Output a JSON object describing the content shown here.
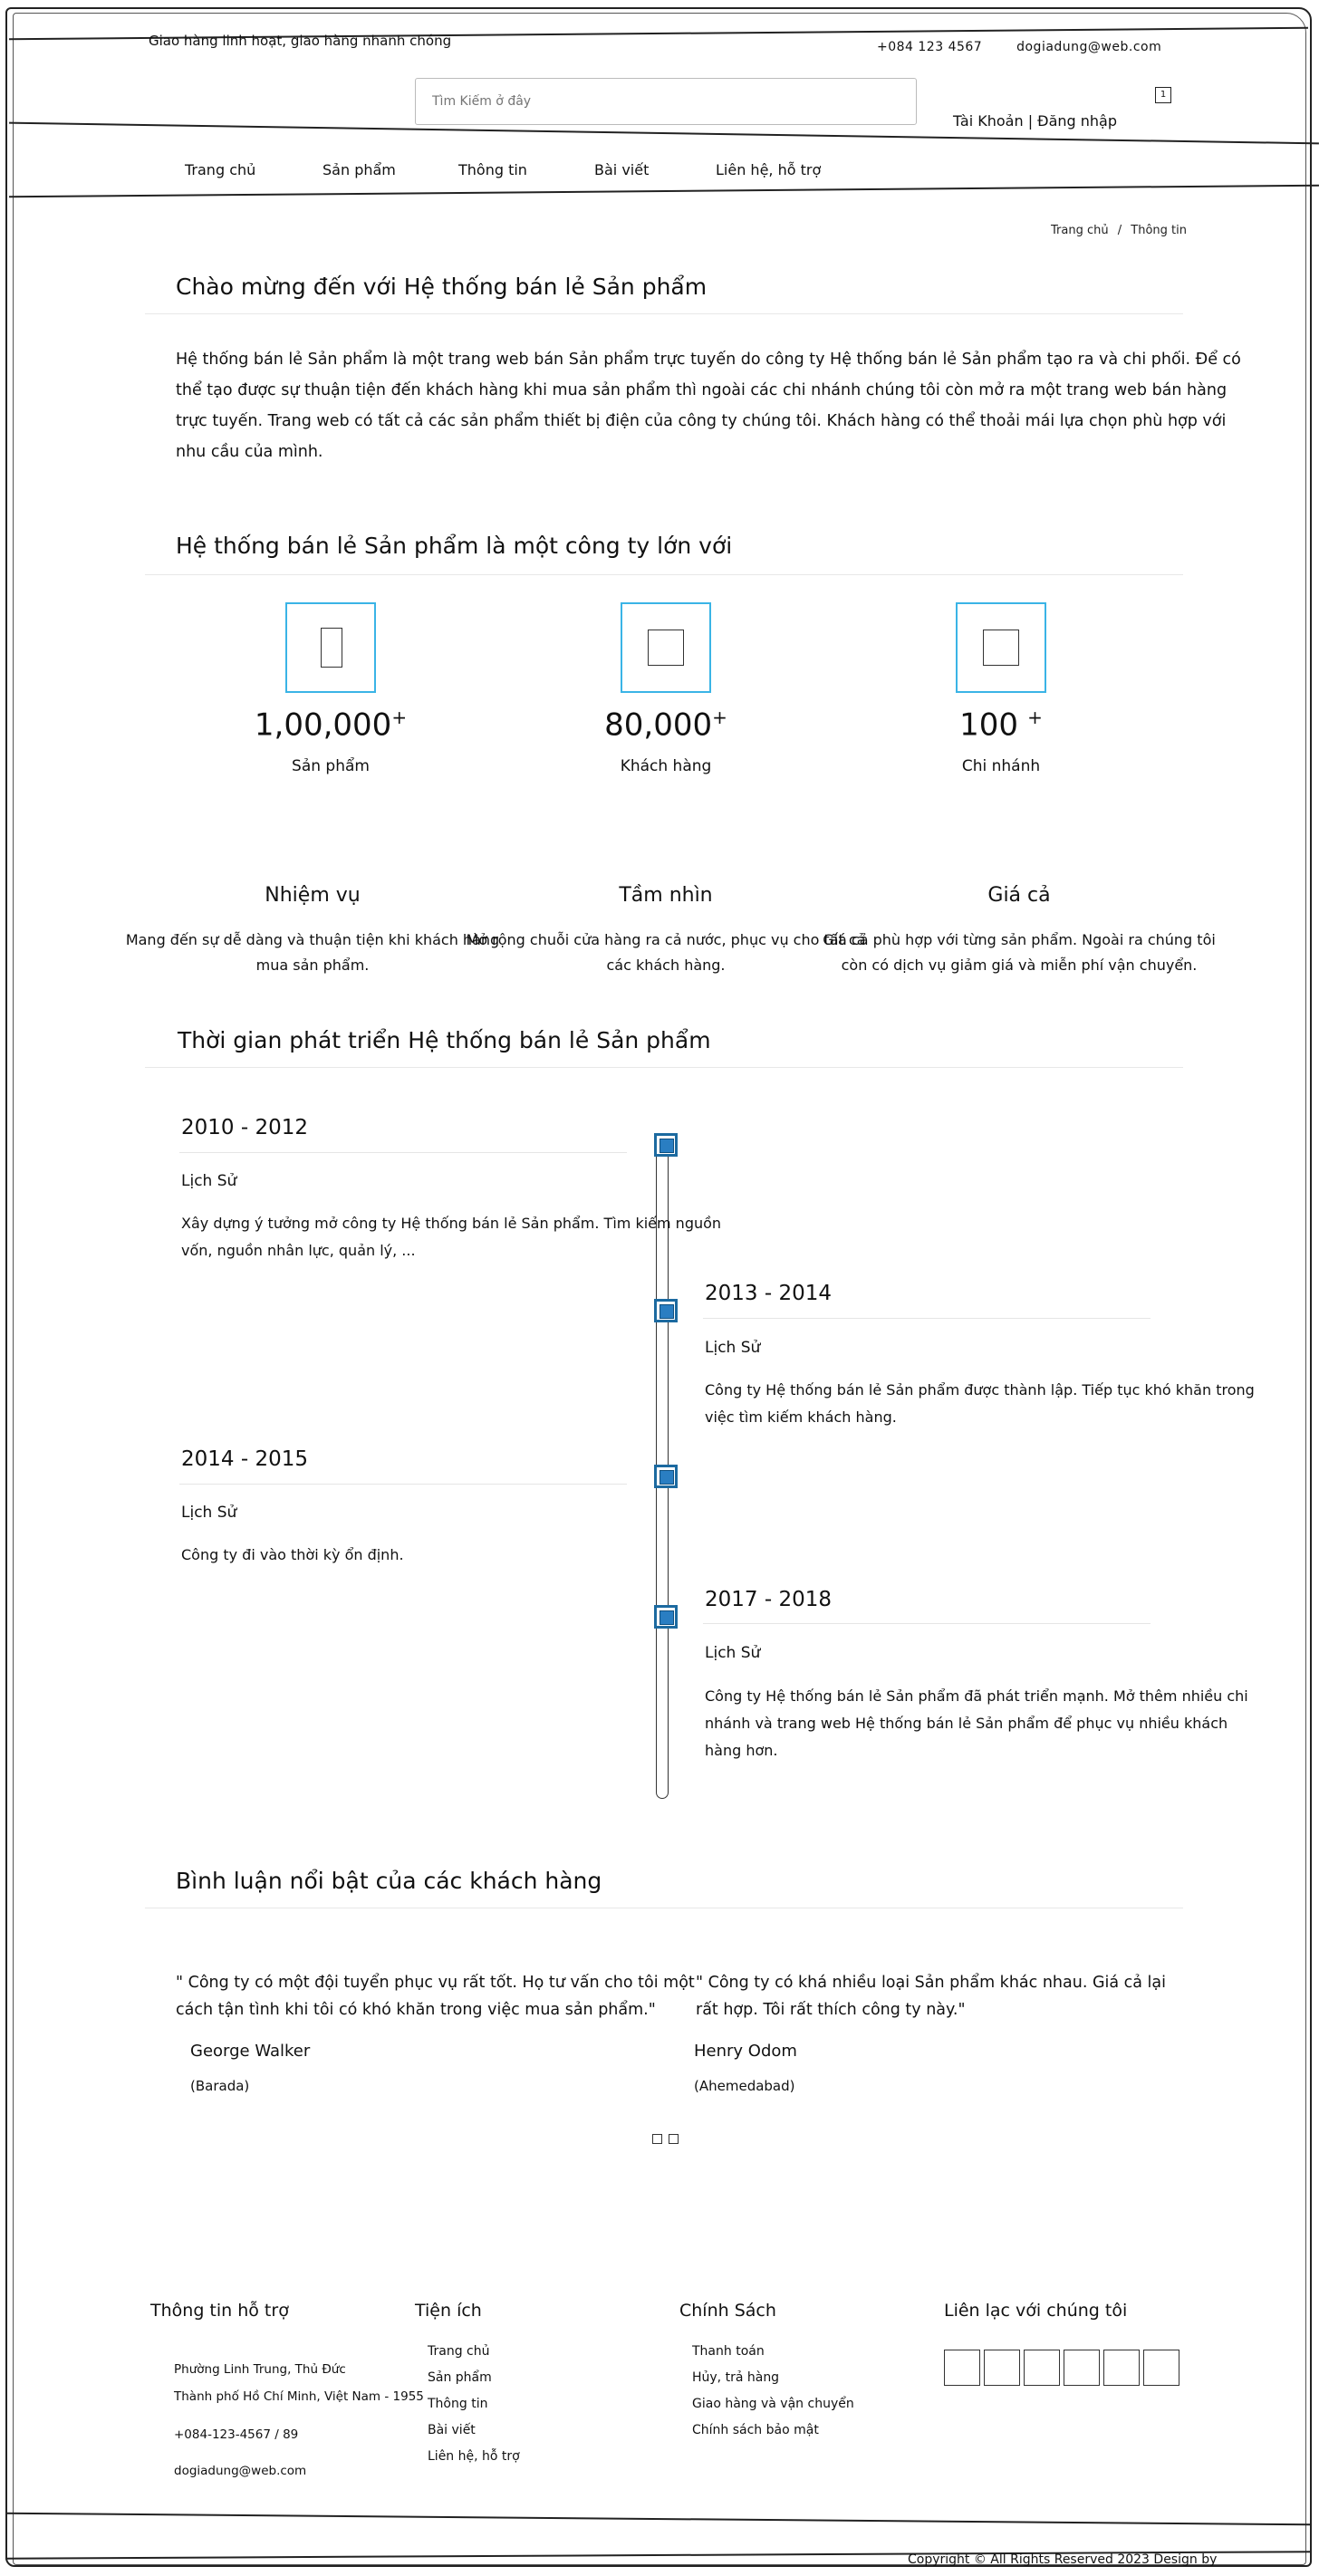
{
  "topbar": {
    "tagline": "Giao hàng linh hoạt, giao hàng nhanh chóng",
    "phone": "+084 123 4567",
    "email": "dogiadung@web.com"
  },
  "header": {
    "search_placeholder": "Tìm Kiếm ở đây",
    "cart_count": "1",
    "account_label": "Tài Khoản | Đăng nhập"
  },
  "nav": {
    "items": [
      "Trang chủ",
      "Sản phẩm",
      "Thông tin",
      "Bài viết",
      "Liên hệ, hỗ trợ"
    ]
  },
  "breadcrumb": {
    "home": "Trang chủ",
    "separator": "/",
    "current": "Thông tin"
  },
  "welcome": {
    "title": "Chào mừng đến với Hệ thống bán lẻ Sản phẩm",
    "paragraph": "Hệ thống bán lẻ Sản phẩm là một trang web bán Sản phẩm trực tuyến do công ty Hệ thống bán lẻ Sản phẩm tạo ra và chi phối. Để có thể tạo được sự thuận tiện đến khách hàng khi mua sản phẩm thì ngoài các chi nhánh chúng tôi còn mở ra một trang web bán hàng trực tuyến. Trang web có tất cả các sản phẩm thiết bị điện của công ty chúng tôi. Khách hàng có thể thoải mái lựa chọn phù hợp với nhu cầu của mình."
  },
  "stats": {
    "title": "Hệ thống bán lẻ Sản phẩm là một công ty lớn với",
    "items": [
      {
        "number": "1,00,000",
        "suffix": "+",
        "label": "Sản phẩm",
        "icon": "product-icon"
      },
      {
        "number": "80,000",
        "suffix": "+",
        "label": "Khách hàng",
        "icon": "customer-icon"
      },
      {
        "number": "100",
        "suffix": "+",
        "label": "Chi nhánh",
        "icon": "branch-icon"
      }
    ]
  },
  "mission": {
    "items": [
      {
        "title": "Nhiệm vụ",
        "text": "Mang đến sự dễ dàng và thuận tiện khi khách hàng mua sản phẩm."
      },
      {
        "title": "Tầm nhìn",
        "text": "Mở rộng chuỗi cửa hàng ra cả nước, phục vụ cho tất cả các khách hàng."
      },
      {
        "title": "Giá cả",
        "text": "Giá cả phù hợp với từng sản phẩm. Ngoài ra chúng tôi còn có dịch vụ giảm giá và miễn phí vận chuyển."
      }
    ]
  },
  "timeline": {
    "title": "Thời gian phát triển Hệ thống bán lẻ Sản phẩm",
    "entries": [
      {
        "date": "2010 - 2012",
        "subtitle": "Lịch Sử",
        "text": "Xây dựng ý tưởng mở công ty Hệ thống bán lẻ Sản phẩm. Tìm kiếm nguồn vốn, nguồn nhân lực, quản lý, ..."
      },
      {
        "date": "2013 - 2014",
        "subtitle": "Lịch Sử",
        "text": "Công ty Hệ thống bán lẻ Sản phẩm được thành lập. Tiếp tục khó khăn trong việc tìm kiếm khách hàng."
      },
      {
        "date": "2014 - 2015",
        "subtitle": "Lịch Sử",
        "text": "Công ty đi vào thời kỳ ổn định."
      },
      {
        "date": "2017 - 2018",
        "subtitle": "Lịch Sử",
        "text": "Công ty Hệ thống bán lẻ Sản phẩm đã phát triển mạnh. Mở thêm nhiều chi nhánh và trang web Hệ thống bán lẻ Sản phẩm để phục vụ nhiều khách hàng hơn."
      }
    ]
  },
  "reviews": {
    "title": "Bình luận nổi bật của các khách hàng",
    "items": [
      {
        "quote": "\" Công ty có một đội tuyển phục vụ rất tốt. Họ tư vấn cho tôi một cách tận tình khi tôi có khó khăn trong việc mua sản phẩm.\"",
        "name": "George Walker",
        "place": "(Barada)"
      },
      {
        "quote": "\" Công ty có khá nhiều loại Sản phẩm khác nhau. Giá cả lại rất hợp. Tôi rất thích công ty này.\"",
        "name": "Henry Odom",
        "place": "(Ahemedabad)"
      }
    ]
  },
  "footer": {
    "support": {
      "heading": "Thông tin hỗ trợ",
      "address1": "Phường Linh Trung, Thủ Đức",
      "address2": "Thành phố Hồ Chí Minh, Việt Nam - 1955",
      "phone": "+084-123-4567 / 89",
      "email": "dogiadung@web.com"
    },
    "utilities": {
      "heading": "Tiện ích",
      "links": [
        "Trang chủ",
        "Sản phẩm",
        "Thông tin",
        "Bài viết",
        "Liên hệ, hỗ trợ"
      ]
    },
    "policy": {
      "heading": "Chính Sách",
      "links": [
        "Thanh toán",
        "Hủy, trả hàng",
        "Giao hàng và vận chuyển",
        "Chính sách bảo mật"
      ]
    },
    "contact": {
      "heading": "Liên lạc với chúng tôi",
      "socials": [
        "facebook-icon",
        "twitter-icon",
        "instagram-icon",
        "youtube-icon",
        "linkedin-icon",
        "pinterest-icon"
      ]
    },
    "copyright": "Copyright © All Rights Reserved 2023 Design by"
  },
  "colors": {
    "stat_border": "#3ab4e6",
    "timeline_marker": "#2a7ec2"
  }
}
